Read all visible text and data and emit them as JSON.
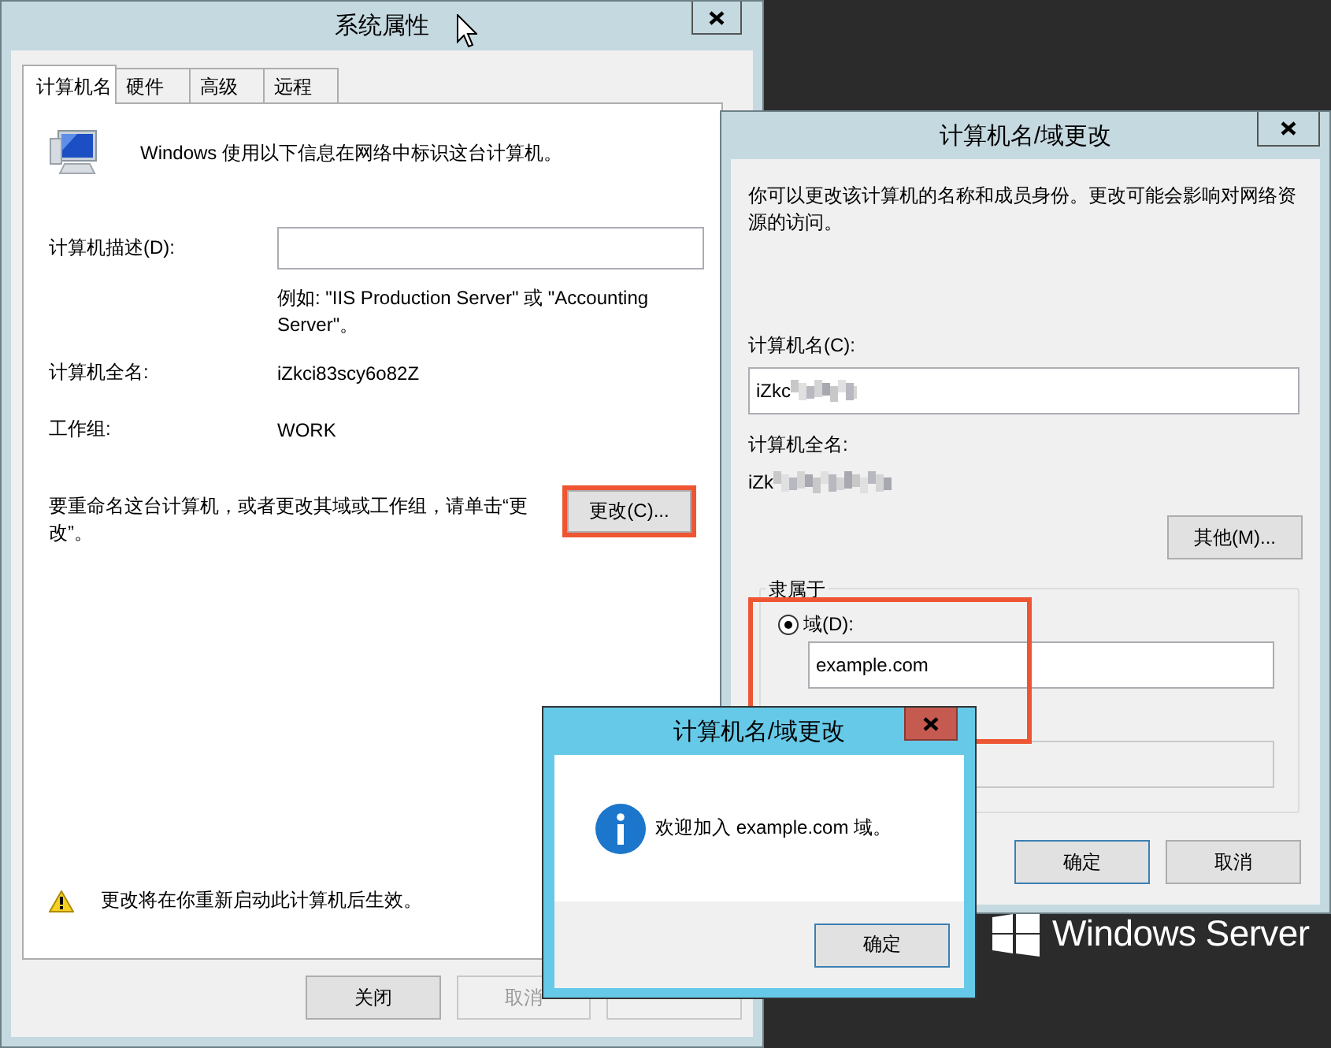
{
  "system_properties": {
    "title": "系统属性",
    "tabs": [
      {
        "label": "计算机名",
        "selected": true
      },
      {
        "label": "硬件",
        "selected": false
      },
      {
        "label": "高级",
        "selected": false
      },
      {
        "label": "远程",
        "selected": false
      }
    ],
    "intro": "Windows 使用以下信息在网络中标识这台计算机。",
    "description": {
      "label": "计算机描述(D):"
    },
    "example": "例如: \"IIS Production Server\" 或 \"Accounting Server\"。",
    "full_name": {
      "label": "计算机全名:",
      "value": "iZkci83scy6o82Z"
    },
    "workgroup": {
      "label": "工作组:",
      "value": "WORK"
    },
    "rename_hint": "要重命名这台计算机，或者更改其域或工作组，请单击“更改”。",
    "change_button": {
      "label": "更改(C)...",
      "highlighted": true
    },
    "warning": "更改将在你重新启动此计算机后生效。",
    "buttons": [
      {
        "label": "关闭",
        "disabled": false
      },
      {
        "label": "取消",
        "disabled": true
      }
    ]
  },
  "name_domain_dialog": {
    "title": "计算机名/域更改",
    "intro": "你可以更改该计算机的名称和成员身份。更改可能会影响对网络资源的访问。",
    "computer_name": {
      "label": "计算机名(C):",
      "value": "iZkc"
    },
    "full_name": {
      "label": "计算机全名:",
      "value": "iZk"
    },
    "more_button": "其他(M)...",
    "member_of": {
      "title": "隶属于",
      "highlighted": true,
      "options": [
        {
          "label": "域(D):",
          "selected": true,
          "value": "example.com"
        }
      ]
    },
    "buttons": [
      "确定",
      "取消"
    ]
  },
  "message_box": {
    "title": "计算机名/域更改",
    "message": "欢迎加入 example.com 域。",
    "button": "确定"
  },
  "branding": "Windows Server"
}
